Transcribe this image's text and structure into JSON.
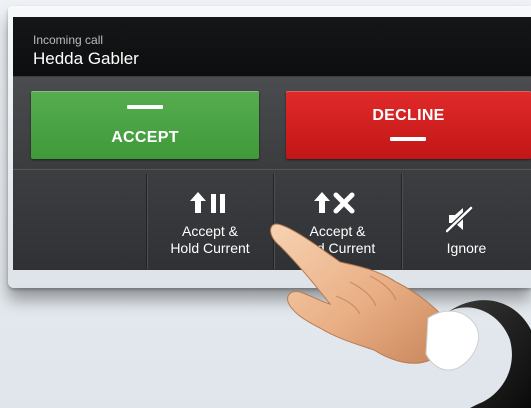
{
  "call": {
    "subtitle": "Incoming call",
    "caller": "Hedda Gabler"
  },
  "buttons": {
    "accept": "ACCEPT",
    "decline": "DECLINE",
    "accept_hold_line1": "Accept &",
    "accept_hold_line2": "Hold Current",
    "accept_end_line1": "Accept &",
    "accept_end_line2": "End Current",
    "ignore": "Ignore"
  },
  "icons": {
    "accept_hold": "arrow-up-pause-icon",
    "accept_end": "arrow-up-x-icon",
    "ignore": "mute-speaker-icon",
    "pointer": "hand-pointer-icon"
  },
  "colors": {
    "accept": "#4aa344",
    "decline": "#d01f1f",
    "screen": "#2b2d30",
    "header": "#111213"
  }
}
